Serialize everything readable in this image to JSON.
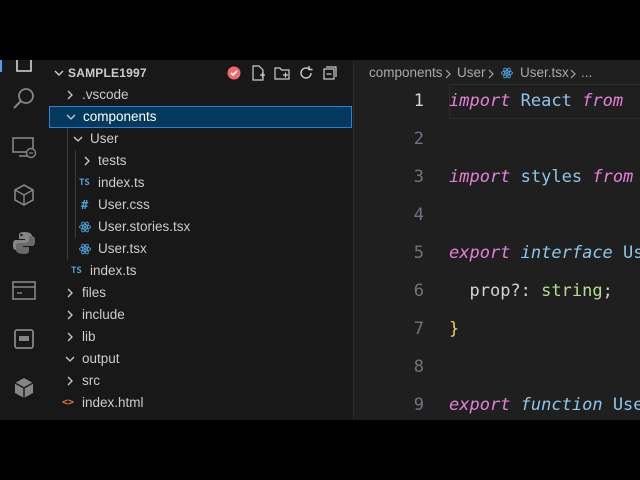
{
  "explorer": {
    "title": "SAMPLE1997"
  },
  "tree": [
    {
      "label": "vscode",
      "prefix": ".",
      "kind": "folder",
      "expanded": false
    },
    {
      "label": "components",
      "kind": "folder",
      "expanded": true,
      "selected": true
    },
    {
      "label": "User",
      "kind": "folder",
      "expanded": true
    },
    {
      "label": "tests",
      "kind": "folder",
      "expanded": false
    },
    {
      "label": "index.ts",
      "kind": "ts",
      "icon_text": "TS"
    },
    {
      "label": "User.css",
      "kind": "css",
      "icon_text": "#"
    },
    {
      "label": "User.stories.tsx",
      "kind": "react"
    },
    {
      "label": "User.tsx",
      "kind": "react"
    },
    {
      "label": "index.ts",
      "kind": "ts",
      "icon_text": "TS"
    },
    {
      "label": "files",
      "kind": "folder",
      "expanded": false
    },
    {
      "label": "include",
      "kind": "folder",
      "expanded": false
    },
    {
      "label": "lib",
      "kind": "folder",
      "expanded": false
    },
    {
      "label": "output",
      "kind": "folder",
      "expanded": true
    },
    {
      "label": "src",
      "kind": "folder",
      "expanded": false
    },
    {
      "label": "index.html",
      "kind": "html",
      "icon_text": "<>"
    }
  ],
  "breadcrumbs": {
    "items": [
      "components",
      "User",
      "User.tsx"
    ],
    "more": "..."
  },
  "editor": {
    "line_numbers": [
      "1",
      "2",
      "3",
      "4",
      "5",
      "6",
      "7",
      "8",
      "9"
    ],
    "lines": {
      "l1": {
        "kw": "import",
        "id": "React",
        "kw_end": "from"
      },
      "l3": {
        "kw": "import",
        "id": "styles",
        "kw_end": "from"
      },
      "l5": {
        "kw": "export",
        "kw2": "interface",
        "id": "Us"
      },
      "l6": {
        "prop": "prop?:",
        "type": "string",
        "semi": ";"
      },
      "l7": {
        "brace": "}"
      },
      "l9": {
        "kw": "export",
        "kw2": "function",
        "id": "Use"
      }
    }
  },
  "colors": {
    "accent": "#4d9df8",
    "selection_bg": "#04395e",
    "keyword": "#e77fd9",
    "identifier": "#8cc6ea",
    "type": "#b8dc8c",
    "brace": "#f5d04f"
  },
  "icons": {
    "activity": [
      "explorer-icon",
      "search-icon",
      "remote-explorer-icon",
      "extensions-icon",
      "python-icon",
      "terminal-icon",
      "panel-icon",
      "packages-icon"
    ],
    "header": [
      "badge-icon",
      "new-file-icon",
      "new-folder-icon",
      "refresh-icon",
      "collapse-all-icon"
    ]
  }
}
